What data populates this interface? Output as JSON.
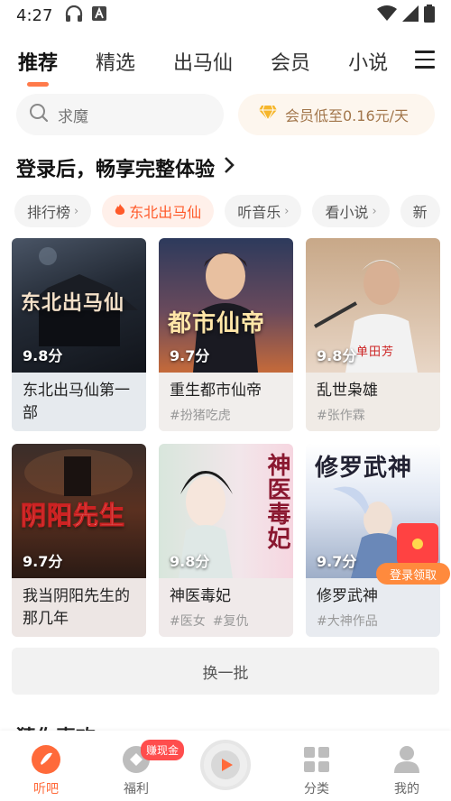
{
  "status_bar": {
    "time": "4:27"
  },
  "top_nav": {
    "tabs": [
      {
        "label": "推荐",
        "active": true
      },
      {
        "label": "精选",
        "active": false
      },
      {
        "label": "出马仙",
        "active": false
      },
      {
        "label": "会员",
        "active": false
      },
      {
        "label": "小说",
        "active": false
      }
    ]
  },
  "search": {
    "value": "求魔"
  },
  "vip_promo": {
    "label": "会员低至0.16元/天"
  },
  "login_banner": {
    "text": "登录后，畅享完整体验"
  },
  "chips": [
    {
      "label": "排行榜",
      "arrow": true,
      "active": false
    },
    {
      "label": "东北出马仙",
      "arrow": false,
      "active": true
    },
    {
      "label": "听音乐",
      "arrow": true,
      "active": false
    },
    {
      "label": "看小说",
      "arrow": true,
      "active": false
    },
    {
      "label": "新",
      "arrow": false,
      "active": false
    }
  ],
  "books": [
    {
      "title": "东北出马仙第一部",
      "rating": "9.8分",
      "tags": []
    },
    {
      "title": "重生都市仙帝",
      "rating": "9.7分",
      "tags": [
        "#扮猪吃虎"
      ]
    },
    {
      "title": "乱世枭雄",
      "rating": "9.8分",
      "tags": [
        "#张作霖"
      ]
    },
    {
      "title": "我当阴阳先生的那几年",
      "rating": "9.7分",
      "tags": []
    },
    {
      "title": "神医毒妃",
      "rating": "9.8分",
      "tags": [
        "#医女",
        "#复仇"
      ]
    },
    {
      "title": "修罗武神",
      "rating": "9.7分",
      "tags": [
        "#大神作品"
      ]
    }
  ],
  "cover_art_text": [
    "东北出马仙",
    "都市仙帝",
    "单田芳",
    "阴阳先生",
    "神医毒妃",
    "修罗武神"
  ],
  "login_claim": "登录领取",
  "refresh_button": "换一批",
  "next_section": "猜你喜欢",
  "bottom_nav": {
    "items": [
      {
        "label": "听吧",
        "active": true
      },
      {
        "label": "福利",
        "active": false
      },
      {
        "label": "分类",
        "active": false
      },
      {
        "label": "我的",
        "active": false
      }
    ],
    "badge": "赚现金"
  },
  "colors": {
    "accent": "#ff6a3a",
    "vip_text": "#a2764b"
  }
}
